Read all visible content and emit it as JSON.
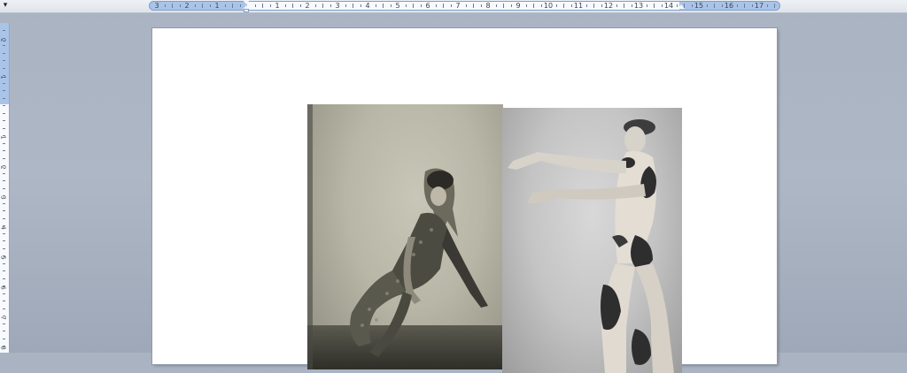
{
  "ruler": {
    "tab_selector_glyph": "▾",
    "numbers": [
      "3",
      "2",
      "1",
      "1",
      "2",
      "3",
      "4",
      "5",
      "6",
      "7",
      "8",
      "9",
      "10",
      "11",
      "12",
      "13",
      "14",
      "15",
      "16",
      "17"
    ]
  },
  "vertical_ruler": {
    "numbers": [
      "2",
      "1",
      "1",
      "2",
      "3",
      "4",
      "5",
      "6",
      "7",
      "8"
    ]
  },
  "document": {
    "images": [
      {
        "name": "dancer-kneeling-photo",
        "description_icon": "photo-icon"
      },
      {
        "name": "dancer-gesturing-photo",
        "description_icon": "photo-icon"
      }
    ]
  }
}
